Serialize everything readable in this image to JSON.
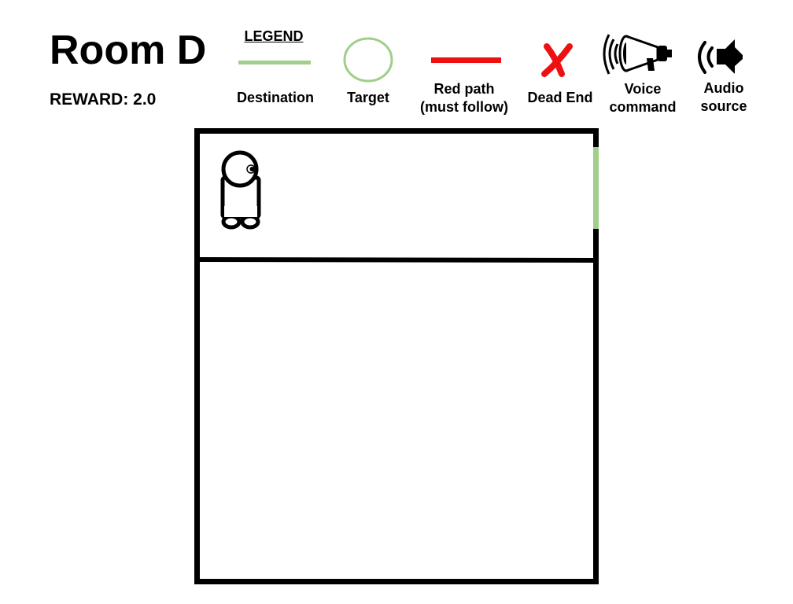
{
  "header": {
    "room_title": "Room D",
    "reward": "REWARD: 2.0"
  },
  "legend": {
    "heading": "LEGEND",
    "items": [
      {
        "label": "Destination",
        "icon": "green-line-swatch",
        "color": "#9fcf8a"
      },
      {
        "label": "Target",
        "icon": "green-circle-swatch",
        "color": "#9fcf8a"
      },
      {
        "label": "Red path\n(must follow)",
        "icon": "red-line-swatch",
        "color": "#ee1111"
      },
      {
        "label": "Dead End",
        "icon": "red-x-icon",
        "color": "#ee1111"
      },
      {
        "label": "Voice\ncommand",
        "icon": "megaphone-icon",
        "color": "#000000"
      },
      {
        "label": "Audio\nsource",
        "icon": "speaker-icon",
        "color": "#000000"
      }
    ]
  },
  "map": {
    "wall_color": "#000000",
    "destination_color": "#9fcf8a",
    "agent": "stick-figure-agent",
    "agent_facing": "right",
    "regions": [
      "upper-corridor",
      "lower-room"
    ]
  }
}
